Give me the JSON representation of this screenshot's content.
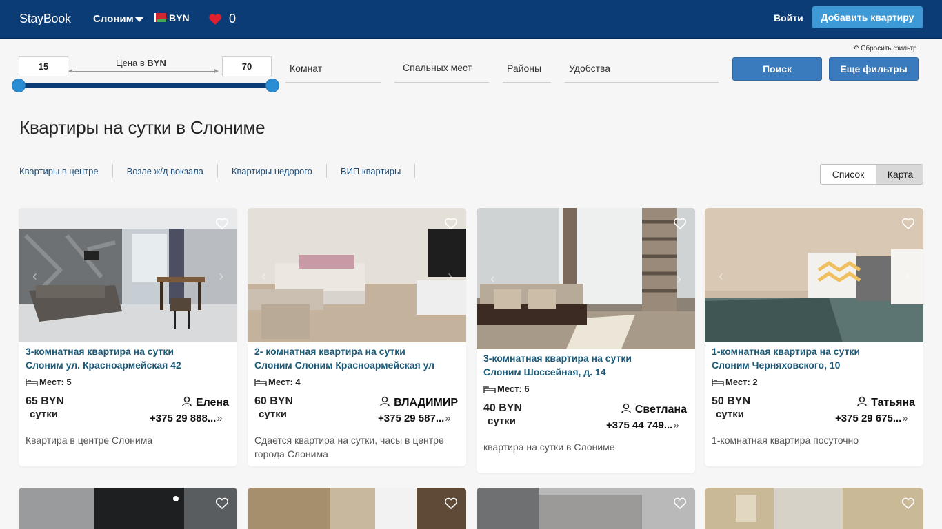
{
  "header": {
    "logo": "StayBook",
    "city": "Слоним",
    "currency": "BYN",
    "favorites_count": "0",
    "login": "Войти",
    "add_apartment": "Добавить квартиру"
  },
  "filters": {
    "price_min": "15",
    "price_max": "70",
    "price_label": "Цена в",
    "price_currency": "BYN",
    "price_range": {
      "min_value": 15,
      "max_value": 70
    },
    "rooms": "Комнат",
    "beds": "Спальных мест",
    "districts": "Районы",
    "amenities": "Удобства",
    "reset": "Сбросить фильтр",
    "search": "Поиск",
    "more_filters": "Еще фильтры"
  },
  "page": {
    "title": "Квартиры на сутки в Слониме",
    "quick_links": [
      "Квартиры в центре",
      "Возле ж/д вокзала",
      "Квартиры недорого",
      "ВИП квартиры"
    ],
    "view_list": "Список",
    "view_map": "Карта"
  },
  "listings": [
    {
      "title_line1": "3-комнатная квартира на сутки",
      "title_line2": "Слоним ул. Красноармейская 42",
      "places": "Мест: 5",
      "price": "65 BYN",
      "per": "сутки",
      "owner": "Елена",
      "phone": "+375 29 888...",
      "description": "Квартира в центре Слонима"
    },
    {
      "title_line1": "2- комнатная квартира на сутки",
      "title_line2": "Слоним Слоним Красноармейская ул",
      "places": "Мест: 4",
      "price": "60 BYN",
      "per": "сутки",
      "owner": "ВЛАДИМИР",
      "phone": "+375 29 587...",
      "description": "Сдается квартира на сутки, часы в центре города Слонима"
    },
    {
      "title_line1": "3-комнатная квартира на сутки",
      "title_line2": "Слоним Шоссейная, д. 14",
      "places": "Мест: 6",
      "price": "40 BYN",
      "per": "сутки",
      "owner": "Светлана",
      "phone": "+375 44 749...",
      "description": "квартира на сутки в Слониме"
    },
    {
      "title_line1": "1-комнатная квартира на сутки",
      "title_line2": "Слоним Черняховского, 10",
      "places": "Мест: 2",
      "price": "50 BYN",
      "per": "сутки",
      "owner": "Татьяна",
      "phone": "+375 29 675...",
      "description": "1-комнатная квартира посуточно"
    }
  ],
  "colors": {
    "header_bg": "#0b3c76",
    "accent": "#3a7bbd",
    "title_link": "#1a5a78",
    "heart": "#e0202e"
  }
}
